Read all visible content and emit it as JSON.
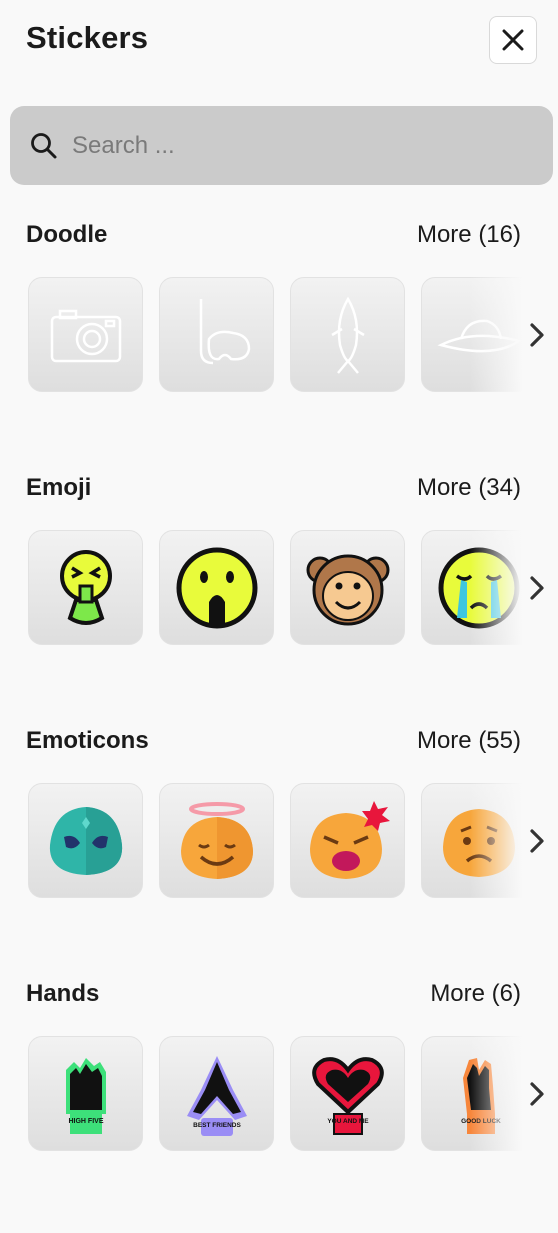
{
  "header": {
    "title": "Stickers"
  },
  "search": {
    "placeholder": "Search ..."
  },
  "sections": [
    {
      "title": "Doodle",
      "more": "More (16)",
      "stickers": [
        "camera-doodle",
        "snorkel-mask-doodle",
        "fish-doodle",
        "sun-hat-doodle"
      ]
    },
    {
      "title": "Emoji",
      "more": "More (34)",
      "stickers": [
        "vomiting-face-emoji",
        "screaming-face-emoji",
        "monkey-face-emoji",
        "crying-face-emoji"
      ]
    },
    {
      "title": "Emoticons",
      "more": "More (55)",
      "stickers": [
        "alien-emoticon",
        "angel-emoticon",
        "angry-emoticon",
        "worried-emoticon"
      ]
    },
    {
      "title": "Hands",
      "more": "More (6)",
      "stickers": [
        "high-five-hand",
        "best-friends-hands",
        "you-and-me-hands",
        "good-luck-hand"
      ],
      "sticker_texts": [
        "HIGH FIVE",
        "BEST FRIENDS",
        "YOU AND ME",
        "GOOD LUCK"
      ]
    }
  ],
  "icons": {
    "search": "search-icon",
    "close": "close-icon",
    "next": "chevron-right-icon"
  },
  "colors": {
    "background": "#f9f9f9",
    "search_bg": "#cbcbcb",
    "emoji_yellow": "#e8fb3b",
    "emoticon_orange": "#f7a63b",
    "alien_teal": "#2fb5a8"
  }
}
